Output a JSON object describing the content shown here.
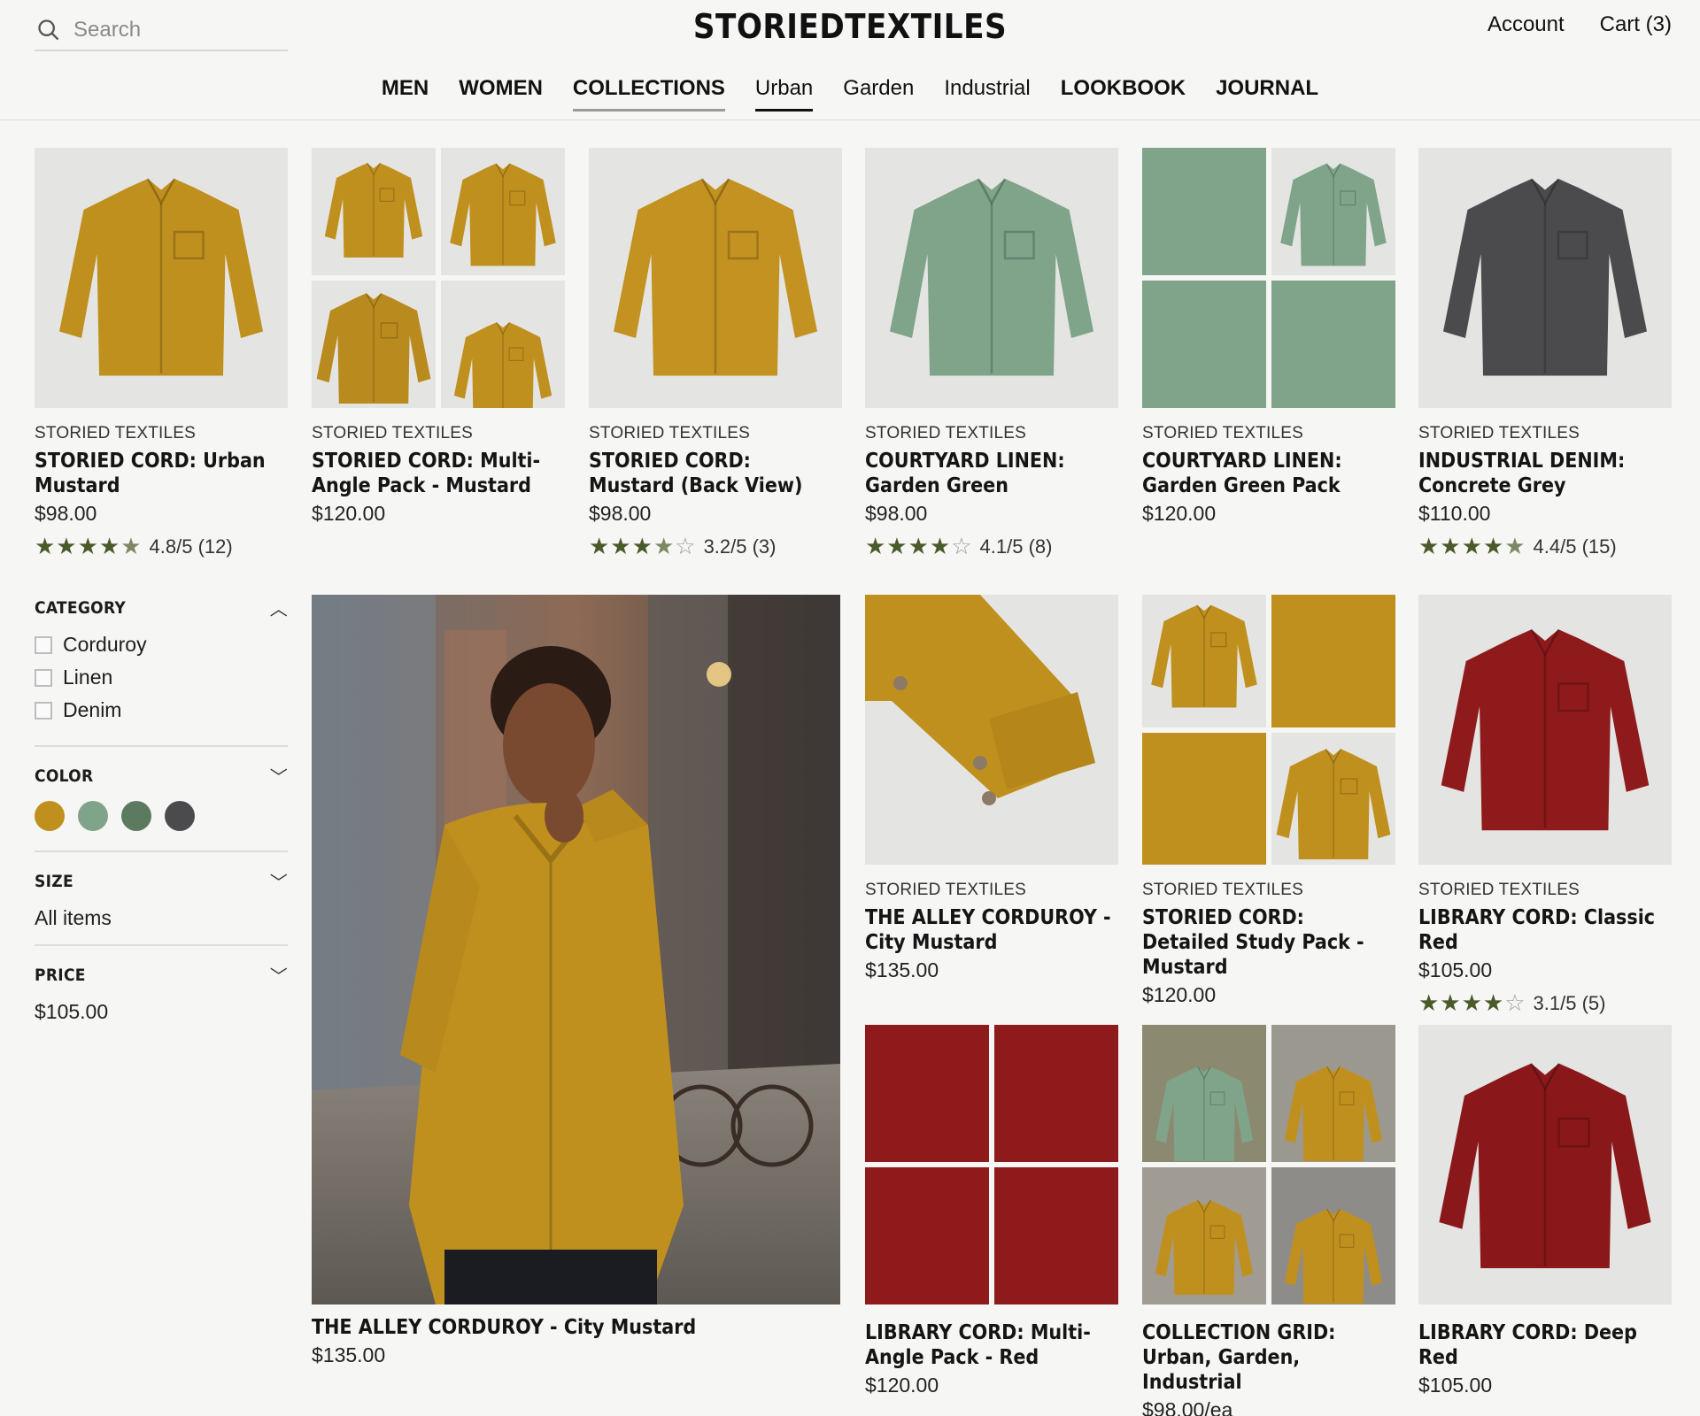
{
  "header": {
    "search_placeholder": "Search",
    "brand": "STORIEDTEXTILES",
    "account": "Account",
    "cart": "Cart (3)"
  },
  "nav": [
    {
      "label": "MEN"
    },
    {
      "label": "WOMEN"
    },
    {
      "label": "COLLECTIONS"
    },
    {
      "label": "Urban"
    },
    {
      "label": "Garden"
    },
    {
      "label": "Industrial"
    },
    {
      "label": "LOOKBOOK"
    },
    {
      "label": "JOURNAL"
    }
  ],
  "products": [
    {
      "brand": "STORIED TEXTILES",
      "name": "STORIED CORD: Urban Mustard",
      "price": "$98.00",
      "rating_text": "4.8/5 (12)",
      "stars": 4.8
    },
    {
      "brand": "STORIED TEXTILES",
      "name": "STORIED CORD: Multi-Angle Pack - Mustard",
      "price": "$120.00"
    },
    {
      "brand": "STORIED TEXTILES",
      "name": "STORIED CORD: Mustard (Back View)",
      "price": "$98.00",
      "rating_text": "3.2/5 (3)",
      "stars": 3.2
    },
    {
      "brand": "STORIED TEXTILES",
      "name": "COURTYARD LINEN: Garden Green",
      "price": "$98.00",
      "rating_text": "4.1/5 (8)",
      "stars": 4.1
    },
    {
      "brand": "STORIED TEXTILES",
      "name": "COURTYARD LINEN: Garden Green Pack",
      "price": "$120.00"
    },
    {
      "brand": "STORIED TEXTILES",
      "name": "INDUSTRIAL DENIM: Concrete Grey",
      "price": "$110.00",
      "rating_text": "4.4/5 (15)",
      "stars": 4.4
    },
    {
      "brand": "STORIED TEXTILES",
      "name": "THE ALLEY CORDUROY - City Mustard",
      "price": "$135.00"
    },
    {
      "brand": "STORIED TEXTILES",
      "name": "STORIED CORD: Detailed Study Pack - Mustard",
      "price": "$120.00"
    },
    {
      "brand": "STORIED TEXTILES",
      "name": "LIBRARY CORD: Classic Red",
      "price": "$105.00",
      "rating_text": "3.1/5 (5)",
      "stars": 3.1
    },
    {
      "name": "LIBRARY CORD: Multi-Angle Pack - Red",
      "price": "$120.00"
    },
    {
      "name": "COLLECTION GRID: Urban, Garden, Industrial",
      "price": "$98.00/ea"
    },
    {
      "name": "LIBRARY CORD: Deep Red",
      "price": "$105.00"
    }
  ],
  "hero": {
    "name": "THE ALLEY CORDUROY - City Mustard",
    "price": "$135.00"
  },
  "filters": {
    "category": {
      "title": "CATEGORY",
      "options": [
        "Corduroy",
        "Linen",
        "Denim"
      ]
    },
    "color": {
      "title": "COLOR",
      "swatches": [
        "#c0901f",
        "#7fa48a",
        "#5b7a60",
        "#4b4b4d"
      ]
    },
    "size": {
      "title": "SIZE",
      "value": "All items"
    },
    "price": {
      "title": "PRICE",
      "value": "$105.00"
    }
  },
  "colors": {
    "mustard": "#c0901f",
    "green": "#7fa48a",
    "grey": "#4b4b4d",
    "red": "#8e1a1c",
    "star": "#4a5a2a"
  }
}
